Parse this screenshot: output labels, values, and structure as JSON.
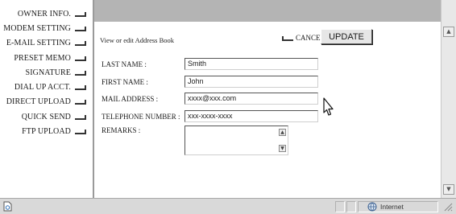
{
  "nav": {
    "items": [
      {
        "label": "OWNER INFO."
      },
      {
        "label": "MODEM SETTING"
      },
      {
        "label": "E-MAIL SETTING"
      },
      {
        "label": "PRESET MEMO"
      },
      {
        "label": "SIGNATURE"
      },
      {
        "label": "DIAL UP ACCT."
      },
      {
        "label": "DIRECT UPLOAD"
      },
      {
        "label": "QUICK SEND"
      },
      {
        "label": "FTP UPLOAD"
      }
    ]
  },
  "form": {
    "caption": "View or edit Address Book",
    "cancel_label": "CANCEL",
    "update_label": "UPDATE",
    "fields": {
      "last_name": {
        "label": "LAST NAME :",
        "value": "Smith"
      },
      "first_name": {
        "label": "FIRST NAME :",
        "value": "John"
      },
      "mail_address": {
        "label": "MAIL ADDRESS :",
        "value": "xxxx@xxx.com"
      },
      "telephone": {
        "label": "TELEPHONE NUMBER :",
        "value": "xxx-xxxx-xxxx"
      },
      "remarks": {
        "label": "REMARKS :",
        "value": ""
      }
    }
  },
  "status_bar": {
    "zone_label": "Internet"
  },
  "icons": {
    "page_status": "page-icon",
    "zone": "globe-icon",
    "pointer": "mouse-cursor-icon"
  },
  "colors": {
    "banner": "#b4b4b4",
    "status_bar": "#d9d9d9"
  }
}
